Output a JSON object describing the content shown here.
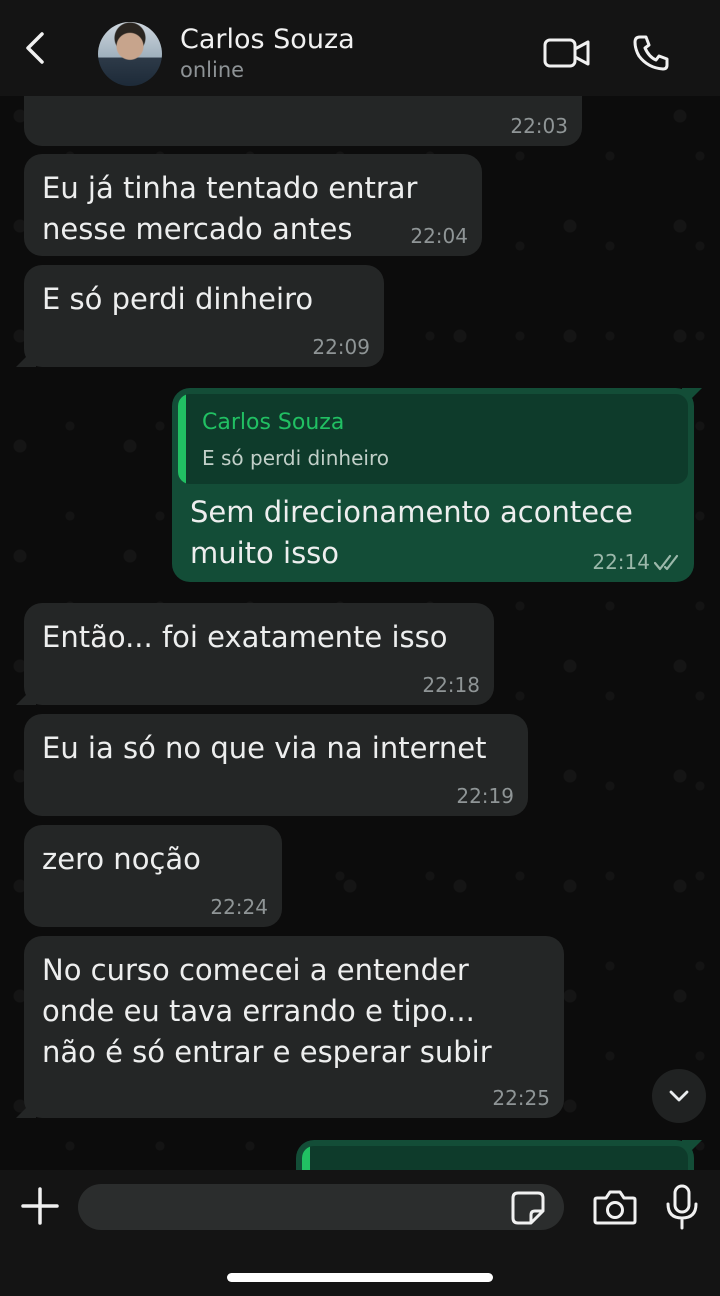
{
  "header": {
    "contact_name": "Carlos Souza",
    "status": "online"
  },
  "messages": [
    {
      "direction": "in",
      "text": "",
      "time": "22:03"
    },
    {
      "direction": "in",
      "text": "Eu já tinha tentado entrar\nnesse mercado antes",
      "time": "22:04"
    },
    {
      "direction": "in",
      "text": "E só perdi dinheiro",
      "time": "22:09"
    },
    {
      "direction": "out",
      "reply_to": {
        "name": "Carlos Souza",
        "text": "E só perdi dinheiro"
      },
      "text": "Sem direcionamento acontece\nmuito isso",
      "time": "22:14",
      "status": "read"
    },
    {
      "direction": "in",
      "text": "Então... foi exatamente isso",
      "time": "22:18"
    },
    {
      "direction": "in",
      "text": "Eu ia só no que via na internet",
      "time": "22:19"
    },
    {
      "direction": "in",
      "text": "zero noção",
      "time": "22:24"
    },
    {
      "direction": "in",
      "text": "No curso comecei a entender\nonde eu tava errando e tipo...\nnão é só entrar e esperar subir",
      "time": "22:25"
    }
  ],
  "input": {
    "placeholder": "",
    "value": ""
  },
  "colors": {
    "incoming_bubble": "#242626",
    "outgoing_bubble": "#134d37",
    "accent": "#21c063"
  }
}
